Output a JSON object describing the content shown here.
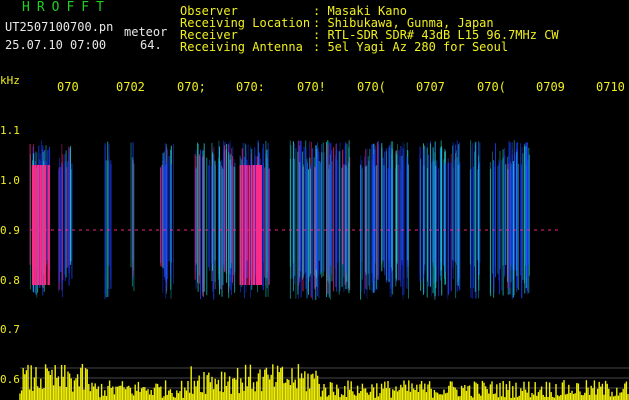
{
  "header": {
    "brand": "HROFFT",
    "filename": "UT2507100700.pn",
    "mode": "meteor",
    "datetime": "25.07.10 07:00",
    "counter": "64.",
    "fields": [
      {
        "label": "Observer",
        "value": ": Masaki Kano"
      },
      {
        "label": "Receiving Location",
        "value": ": Shibukawa, Gunma, Japan"
      },
      {
        "label": "Receiver",
        "value": ": RTL-SDR SDR# 43dB L15 96.7MHz CW"
      },
      {
        "label": "Receiving Antenna",
        "value": ": 5el Yagi Az 280 for Seoul"
      }
    ]
  },
  "axis": {
    "unit": "kHz",
    "y_ticks": [
      "1.1",
      "1.0",
      "0.9",
      "0.8",
      "0.7",
      "0.6"
    ],
    "x_ticks": [
      "070",
      "0702",
      "070;",
      "070:",
      "070!",
      "070(",
      "0707",
      "070(",
      "0709",
      "0710"
    ]
  },
  "colors": {
    "background": "#000000",
    "label": "#f0f020",
    "brand": "#20d020",
    "signal_hot": "#ff2a8a",
    "signal_mid": "#20d0d0",
    "signal_low": "#1a3fff",
    "activity": "#f0f000"
  }
}
